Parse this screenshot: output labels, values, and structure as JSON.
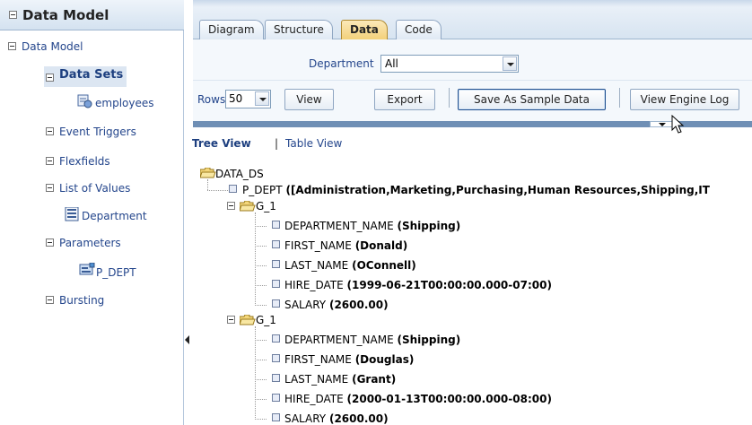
{
  "left_panel": {
    "title": "Data Model",
    "items": [
      {
        "label": "Data Model"
      },
      {
        "label": "Data Sets"
      },
      {
        "label": "employees"
      },
      {
        "label": "Event Triggers"
      },
      {
        "label": "Flexfields"
      },
      {
        "label": "List of Values"
      },
      {
        "label": "Department"
      },
      {
        "label": "Parameters"
      },
      {
        "label": "P_DEPT"
      },
      {
        "label": "Bursting"
      }
    ]
  },
  "tabs": [
    {
      "label": "Diagram"
    },
    {
      "label": "Structure"
    },
    {
      "label": "Data",
      "active": true
    },
    {
      "label": "Code"
    }
  ],
  "parameter": {
    "label": "Department",
    "value": "All"
  },
  "toolbar": {
    "rows_label": "Rows",
    "rows_value": "50",
    "view": "View",
    "export": "Export",
    "save_sample": "Save As Sample Data",
    "engine_log": "View Engine Log"
  },
  "view_links": {
    "tree": "Tree View",
    "separator": "|",
    "table": "Table View"
  },
  "tree": {
    "root": "DATA_DS",
    "p_dept": {
      "name": "P_DEPT",
      "value": "([Administration,Marketing,Purchasing,Human Resources,Shipping,IT"
    },
    "groups": [
      {
        "name": "G_1",
        "fields": [
          {
            "name": "DEPARTMENT_NAME",
            "value": "(Shipping)"
          },
          {
            "name": "FIRST_NAME",
            "value": "(Donald)"
          },
          {
            "name": "LAST_NAME",
            "value": "(OConnell)"
          },
          {
            "name": "HIRE_DATE",
            "value": "(1999-06-21T00:00:00.000-07:00)"
          },
          {
            "name": "SALARY",
            "value": "(2600.00)"
          }
        ]
      },
      {
        "name": "G_1",
        "fields": [
          {
            "name": "DEPARTMENT_NAME",
            "value": "(Shipping)"
          },
          {
            "name": "FIRST_NAME",
            "value": "(Douglas)"
          },
          {
            "name": "LAST_NAME",
            "value": "(Grant)"
          },
          {
            "name": "HIRE_DATE",
            "value": "(2000-01-13T00:00:00.000-08:00)"
          },
          {
            "name": "SALARY",
            "value": "(2600.00)"
          }
        ]
      }
    ]
  },
  "colors": {
    "accent_tab": "#f2cf78",
    "link": "#24468c",
    "rule": "#6f8fb5"
  }
}
